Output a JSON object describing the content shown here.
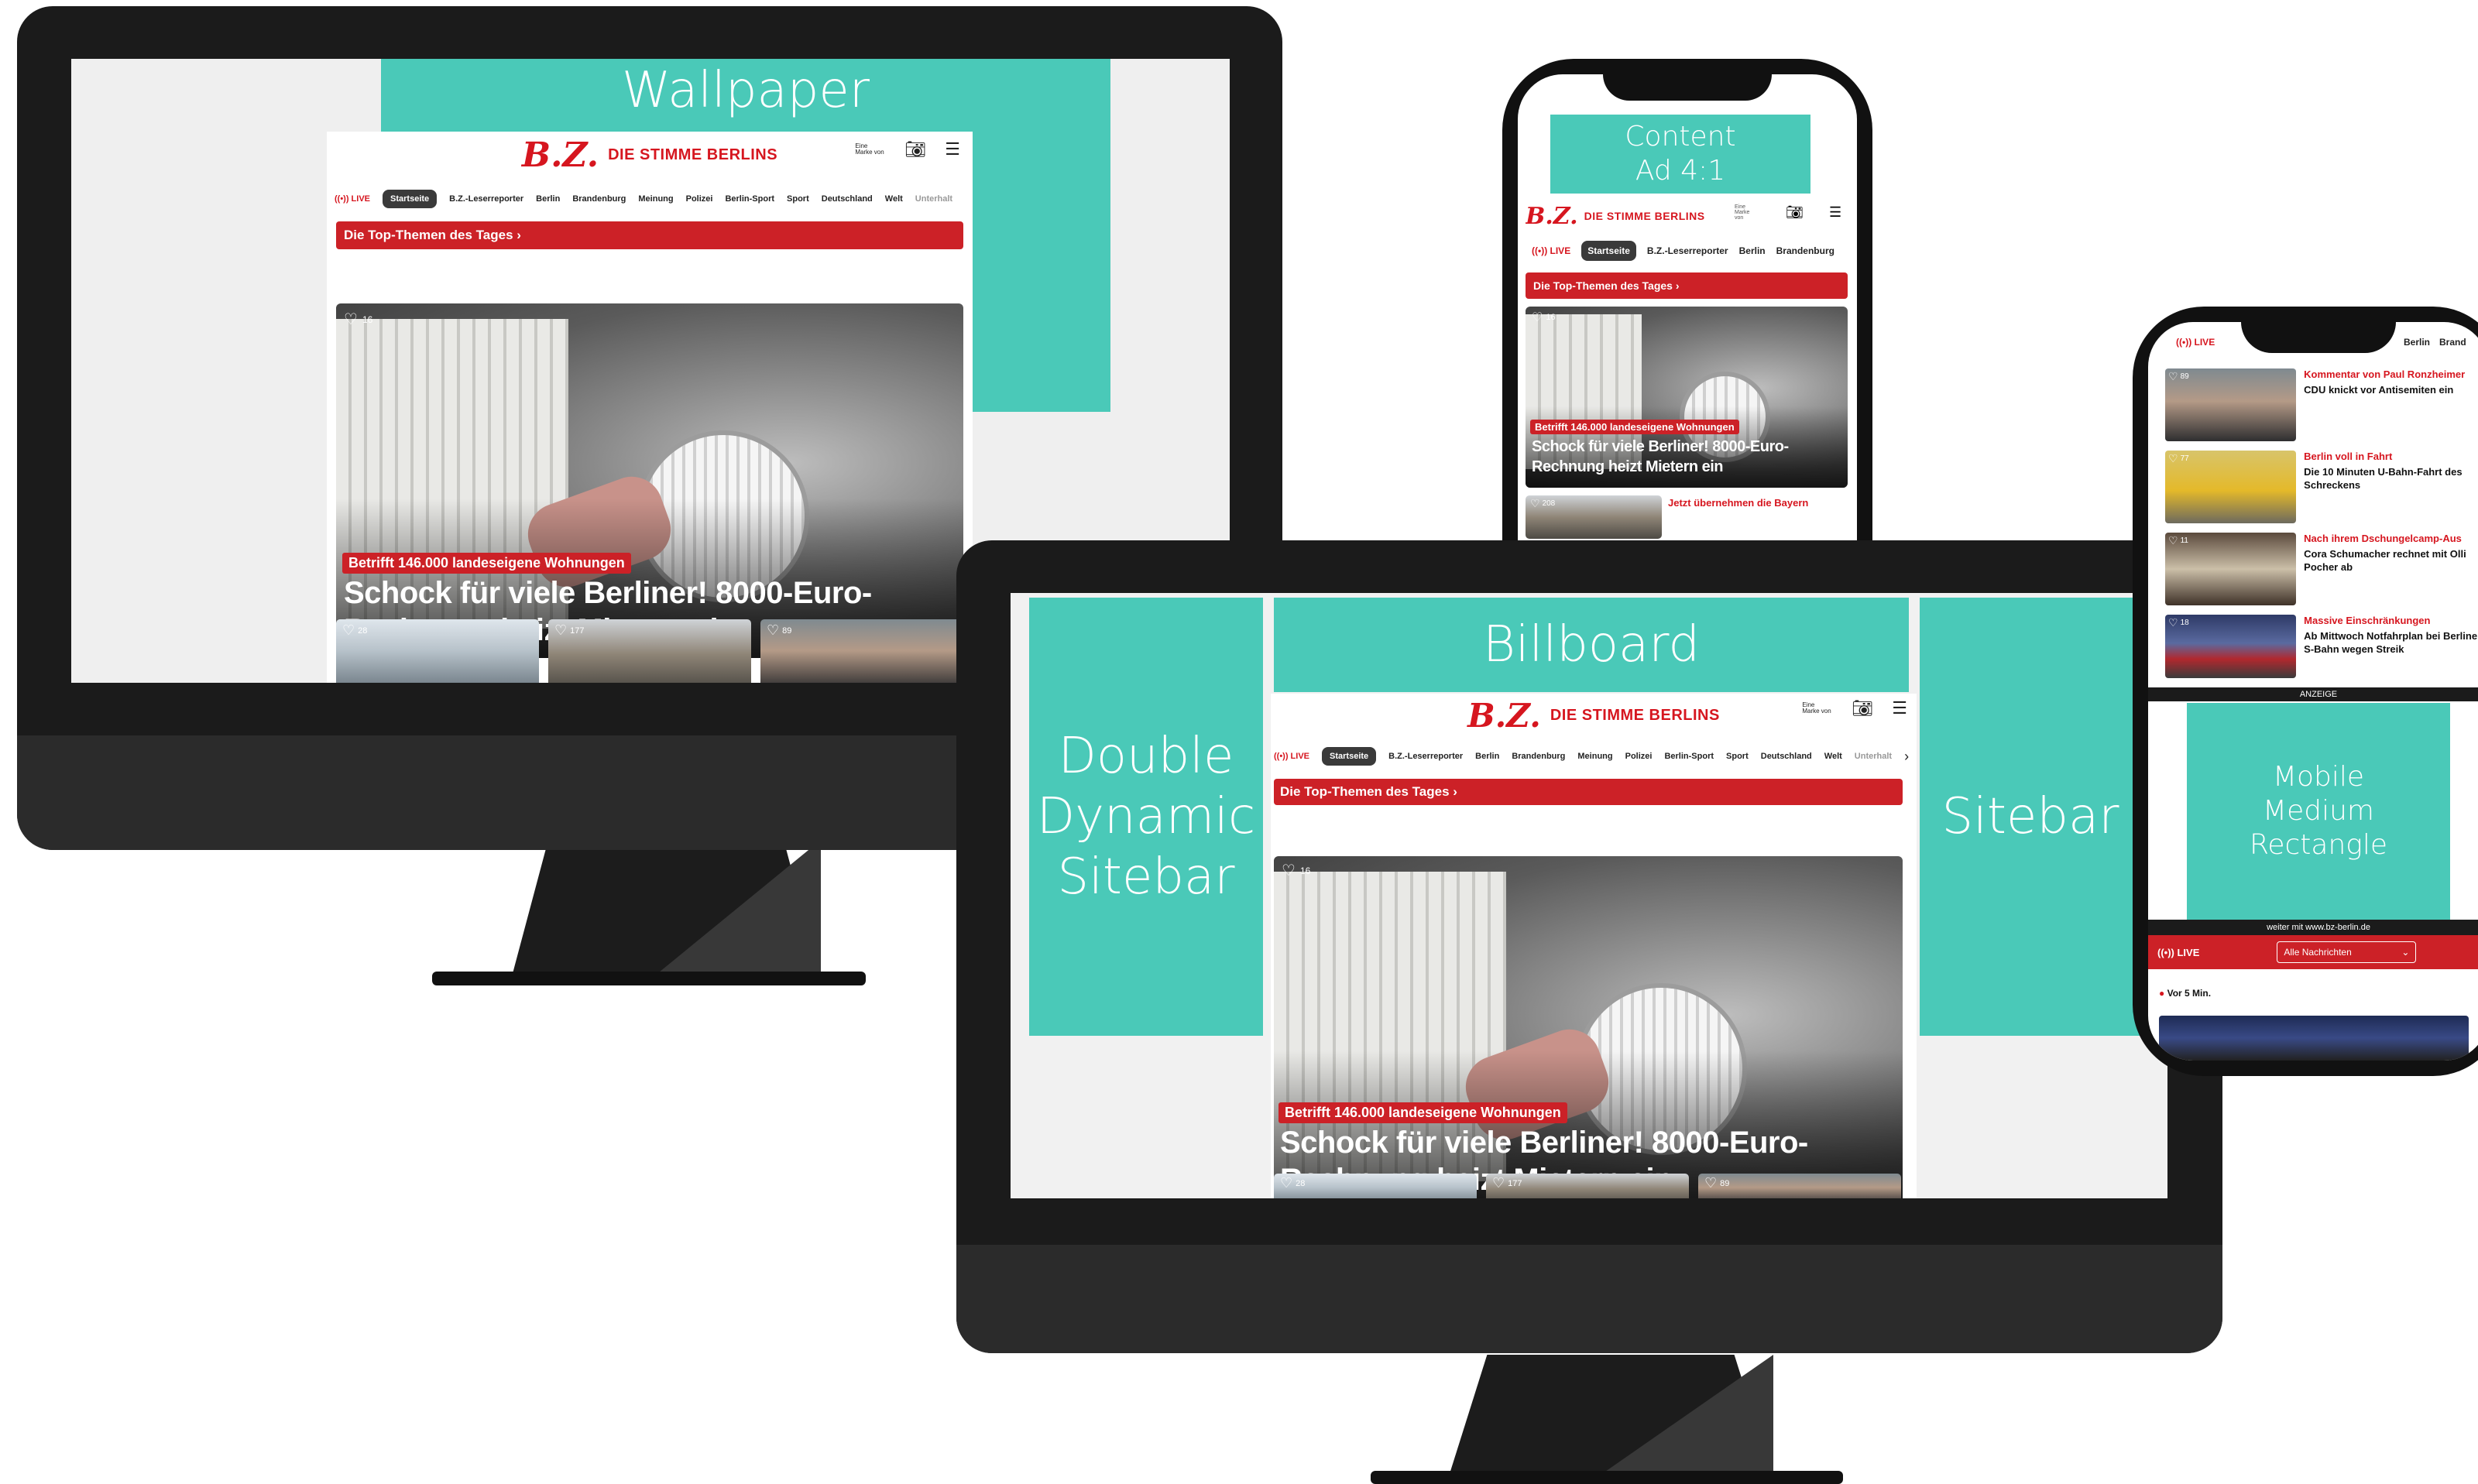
{
  "ad_labels": {
    "wallpaper": "Wallpaper",
    "content_ad_line1": "Content",
    "content_ad_line2": "Ad 4:1",
    "billboard": "Billboard",
    "double_dynamic_line1": "Double",
    "double_dynamic_line2": "Dynamic",
    "double_dynamic_line3": "Sitebar",
    "sitebar": "Sitebar",
    "mobile_mr_line1": "Mobile",
    "mobile_mr_line2": "Medium",
    "mobile_mr_line3": "Rectangle"
  },
  "site": {
    "logo_mark": "B.Z.",
    "logo_claim": "DIE STIMME BERLINS",
    "header_badge": "Eine Marke von",
    "nav": {
      "live": "((•)) LIVE",
      "items": [
        "Startseite",
        "B.Z.-Leserreporter",
        "Berlin",
        "Brandenburg",
        "Meinung",
        "Polizei",
        "Berlin-Sport",
        "Sport",
        "Deutschland",
        "Welt",
        "Unterhalt"
      ],
      "more_arrow": "›"
    },
    "top_themes": "Die Top-Themen des Tages ›",
    "hero": {
      "likes": "16",
      "kicker": "Betrifft 146.000 landeseigene Wohnungen",
      "headline_line1": "Schock für viele Berliner! 8000-Euro-",
      "headline_line2": "Rechnung heizt Mietern ein"
    },
    "thumbs": [
      {
        "likes": "28"
      },
      {
        "likes": "177"
      },
      {
        "likes": "89"
      }
    ],
    "phone1_next_kicker": "Jetzt übernehmen die Bayern",
    "phone1_next_likes": "208"
  },
  "phone2": {
    "nav_live": "((•)) LIVE",
    "nav_items": [
      "Berlin",
      "Brand"
    ],
    "articles": [
      {
        "likes": "89",
        "kicker": "Kommentar von Paul Ronzheimer",
        "title": "CDU knickt vor Antisemiten ein"
      },
      {
        "likes": "77",
        "kicker": "Berlin voll in Fahrt",
        "title": "Die 10 Minuten U-Bahn-Fahrt des Schreckens"
      },
      {
        "likes": "11",
        "kicker": "Nach ihrem Dschungelcamp-Aus",
        "title": "Cora Schumacher rechnet mit Olli Pocher ab"
      },
      {
        "likes": "18",
        "kicker": "Massive Einschränkungen",
        "title": "Ab Mittwoch Notfahrplan bei Berliner S-Bahn wegen Streik"
      }
    ],
    "anzeige": "ANZEIGE",
    "weiter": "weiter mit www.bz-berlin.de",
    "live_label": "((•)) LIVE",
    "dropdown": "Alle Nachrichten",
    "dropdown_chevron": "⌄",
    "time": "Vor 5 Min."
  },
  "colors": {
    "ad_teal": "#4ac9b8",
    "brand_red": "#d6161f",
    "topbar_red": "#cc2127",
    "device_black": "#1b1b1b"
  }
}
